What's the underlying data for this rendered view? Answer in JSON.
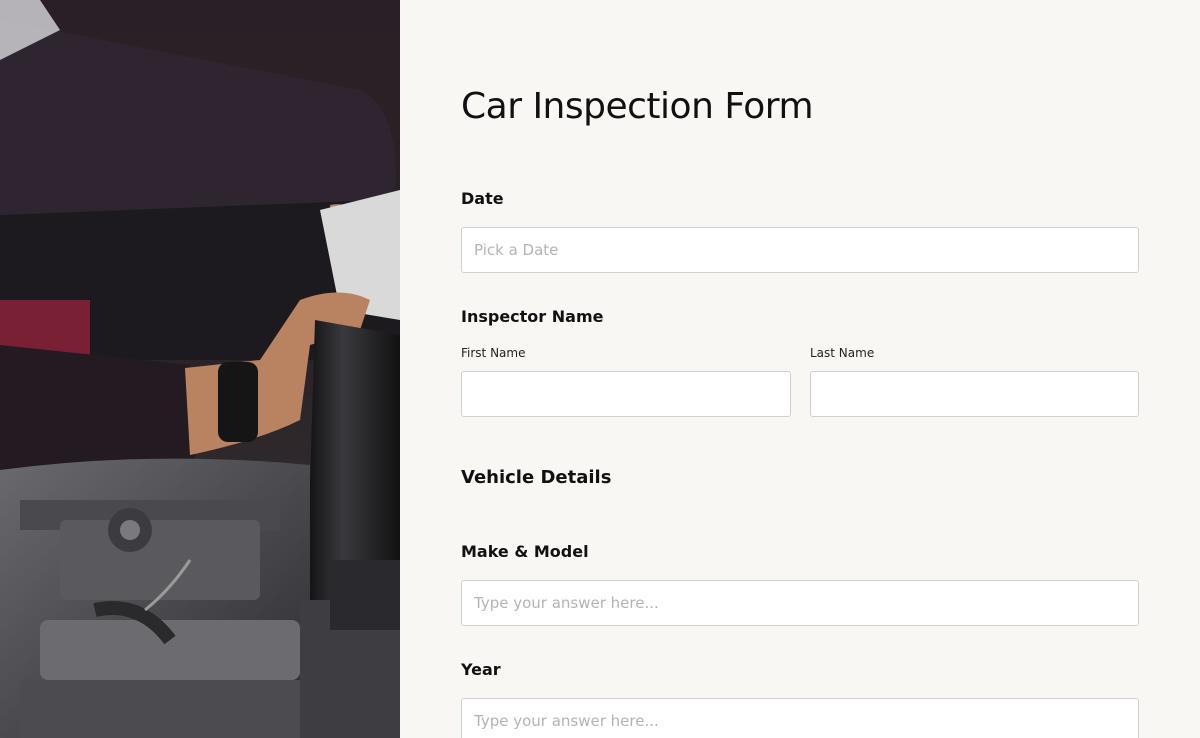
{
  "hero": {
    "image_label": "mechanic-pouring-oil-into-engine"
  },
  "form": {
    "title": "Car Inspection Form",
    "date": {
      "label": "Date",
      "placeholder": "Pick a Date"
    },
    "inspector": {
      "label": "Inspector Name",
      "first_name_label": "First Name",
      "last_name_label": "Last Name",
      "first_name_value": "",
      "last_name_value": ""
    },
    "vehicle_section": {
      "heading": "Vehicle Details"
    },
    "make_model": {
      "label": "Make & Model",
      "placeholder": "Type your answer here..."
    },
    "year": {
      "label": "Year",
      "placeholder": "Type your answer here..."
    }
  },
  "colors": {
    "background": "#f9f7f4",
    "input_border": "#cfcfcf",
    "text": "#111111",
    "placeholder": "#b3b3b3"
  }
}
